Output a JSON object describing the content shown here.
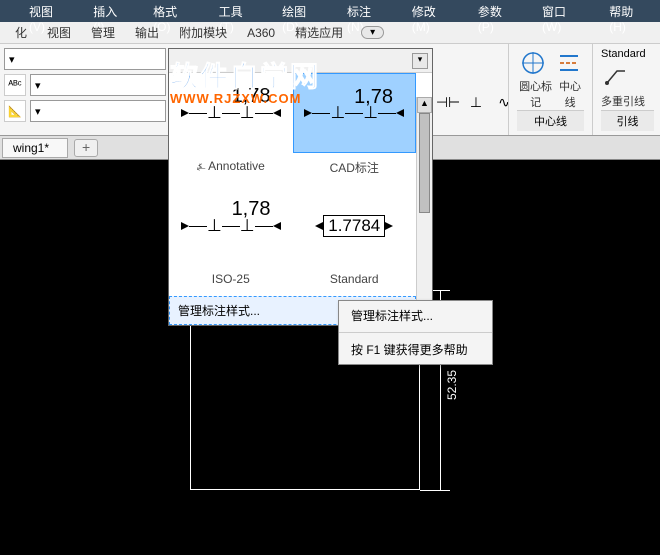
{
  "menubar": [
    "视图(V)",
    "插入(I)",
    "格式(O)",
    "工具(T)",
    "绘图(D)",
    "标注(N)",
    "修改(M)",
    "参数(P)",
    "窗口(W)",
    "帮助(H)"
  ],
  "tabbar": {
    "items": [
      "化",
      "视图",
      "管理",
      "输出",
      "附加模块",
      "A360",
      "精选应用"
    ],
    "dropdown_icon": "▾"
  },
  "ribbon": {
    "small_tools": [
      "⊣⊢",
      "⊥",
      "∿"
    ],
    "panel_circle": {
      "icons_label": [
        "圆心标记",
        "中心线"
      ],
      "title": "中心线"
    },
    "panel_leader": {
      "label": "多重引线",
      "title": "引线",
      "std": "Standard"
    }
  },
  "doc_tab": "wing1*",
  "style_dropdown": {
    "cells": [
      {
        "value": "1,78",
        "name": "Annotative",
        "annotative": true
      },
      {
        "value": "1,78",
        "name": "CAD标注",
        "selected": true
      },
      {
        "value": "1,78",
        "name": "ISO-25"
      },
      {
        "value": "1.7784",
        "name": "Standard",
        "boxed": true
      }
    ],
    "manage": "管理标注样式..."
  },
  "context_menu": {
    "item1": "管理标注样式...",
    "item2": "按 F1 键获得更多帮助"
  },
  "dimension_value": "52.35",
  "watermark": {
    "line1": "软件自学网",
    "line2": "WWW.RJZXW.COM"
  }
}
